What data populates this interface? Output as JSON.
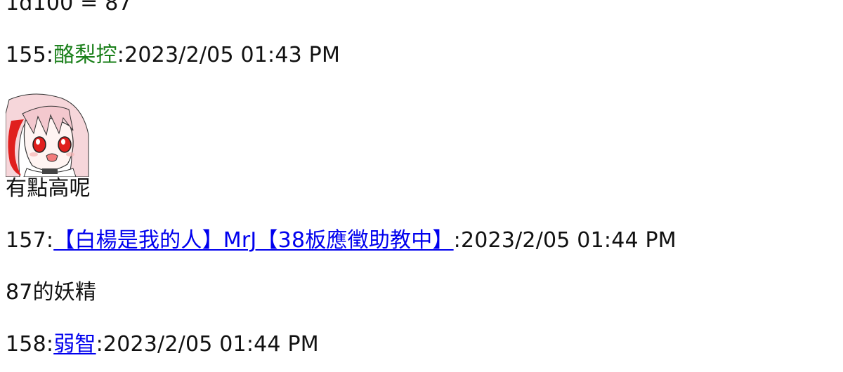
{
  "top_partial": "1d100 = 87",
  "posts": [
    {
      "number": "155",
      "name": "酪梨控",
      "timestamp": "2023/2/05 01:43 PM",
      "name_style": "green",
      "text": "有點高呢"
    },
    {
      "number": "157",
      "name": "【白楊是我的人】MrJ【38板應徵助教中】",
      "timestamp": "2023/2/05 01:44 PM",
      "name_style": "link",
      "text": "87的妖精"
    },
    {
      "number": "158",
      "name": "弱智",
      "timestamp": "2023/2/05 01:44 PM",
      "name_style": "link",
      "text": ""
    }
  ],
  "separator": ":",
  "colors": {
    "link": "#0000ee",
    "green_name": "#1a7f1a",
    "text": "#111111",
    "background": "#ffffff"
  },
  "avatar": {
    "icon": "anime-girl-avatar",
    "description_shown": false
  }
}
